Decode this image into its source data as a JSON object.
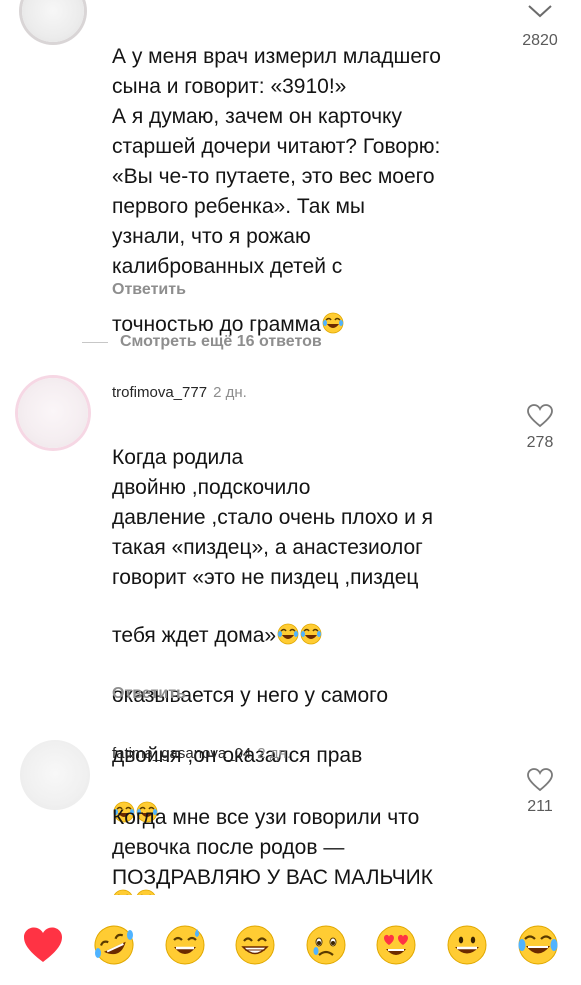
{
  "comments": [
    {
      "text": "А у меня врач измерил младшего\nсына и говорит: «3910!»\nА я думаю, зачем он карточку\nстаршей дочери читают? Говорю:\n«Вы че-то путаете, это вес моего\nпервого ребенка». Так мы\nузнали, что я рожаю\nкалиброванных детей с\nточностью до грамма",
      "likes": "2820",
      "reply_label": "Ответить"
    },
    {
      "username": "trofimova_777",
      "time": "2 дн.",
      "text": "Когда родила\nдвойню ,подскочило\nдавление ,стало очень плохо и я\nтакая «пиздец», а анастезиолог\nговорит «это не пиздец ,пиздец\nтебя ждет дома»",
      "text_tail_1": "оказывается у него у самого",
      "text_tail_2": "двойня ,он оказался прав",
      "likes": "278",
      "reply_label": "Ответить"
    },
    {
      "username": "fatima_gasanova_04",
      "time": "2 дн.",
      "text": "Когда мне все узи говорили что\nдевочка после родов —\nПОЗДРАВЛЯЮ У ВАС МАЛЬЧИК\n—КАК МАЛЬЧИК ? — Все\nвопросы к производителю",
      "likes": "211"
    }
  ],
  "view_more_label": "Смотреть ещё 16 ответов",
  "reaction_bar": [
    "red-heart-icon",
    "rolling-on-floor-laughing-icon",
    "grinning-sweat-icon",
    "beaming-face-icon",
    "crying-face-icon",
    "heart-eyes-icon",
    "grinning-face-icon",
    "tears-of-joy-icon"
  ],
  "colors": {
    "text": "#141414",
    "muted": "#8e8e8e",
    "heart_red": "#ff3040",
    "emoji_yellow": "#ffcc33"
  }
}
